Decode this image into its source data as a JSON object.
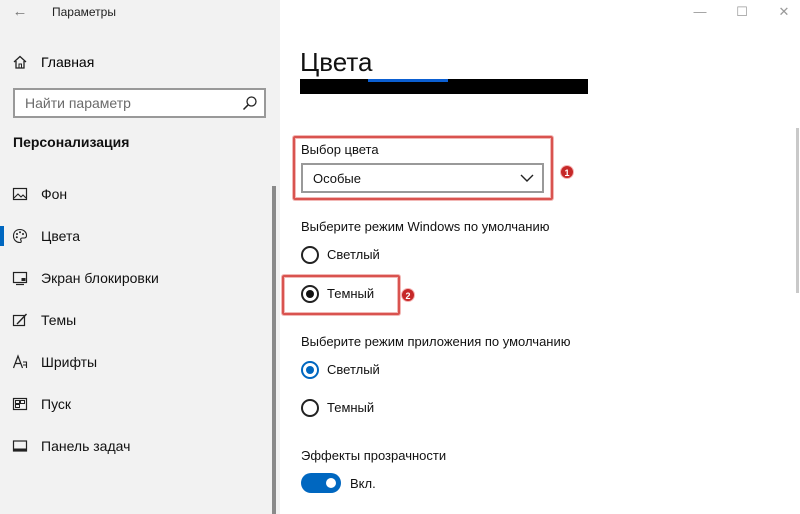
{
  "window": {
    "title": "Параметры",
    "back_glyph": "←",
    "minimize_glyph": "—",
    "maximize_glyph": "☐",
    "close_glyph": "✕"
  },
  "sidebar": {
    "home_label": "Главная",
    "search_placeholder": "Найти параметр",
    "section_title": "Персонализация",
    "items": [
      {
        "label": "Фон",
        "icon": "picture-icon"
      },
      {
        "label": "Цвета",
        "icon": "palette-icon",
        "active": true
      },
      {
        "label": "Экран блокировки",
        "icon": "lock-screen-icon"
      },
      {
        "label": "Темы",
        "icon": "brush-icon"
      },
      {
        "label": "Шрифты",
        "icon": "font-icon"
      },
      {
        "label": "Пуск",
        "icon": "start-grid-icon"
      },
      {
        "label": "Панель задач",
        "icon": "taskbar-icon"
      }
    ]
  },
  "main": {
    "page_title": "Цвета",
    "color_choice": {
      "label": "Выбор цвета",
      "value": "Особые"
    },
    "windows_mode": {
      "label": "Выберите режим Windows по умолчанию",
      "options": [
        {
          "label": "Светлый",
          "checked": false
        },
        {
          "label": "Темный",
          "checked": true
        }
      ]
    },
    "app_mode": {
      "label": "Выберите режим приложения по умолчанию",
      "options": [
        {
          "label": "Светлый",
          "checked": true
        },
        {
          "label": "Темный",
          "checked": false
        }
      ]
    },
    "transparency": {
      "label": "Эффекты прозрачности",
      "state_label": "Вкл.",
      "on": true
    }
  },
  "annotations": {
    "badge_1": "1",
    "badge_2": "2",
    "color": "#d9534f"
  },
  "colors": {
    "accent": "#0067c0",
    "sidebar_bg": "#f2f2f2"
  }
}
